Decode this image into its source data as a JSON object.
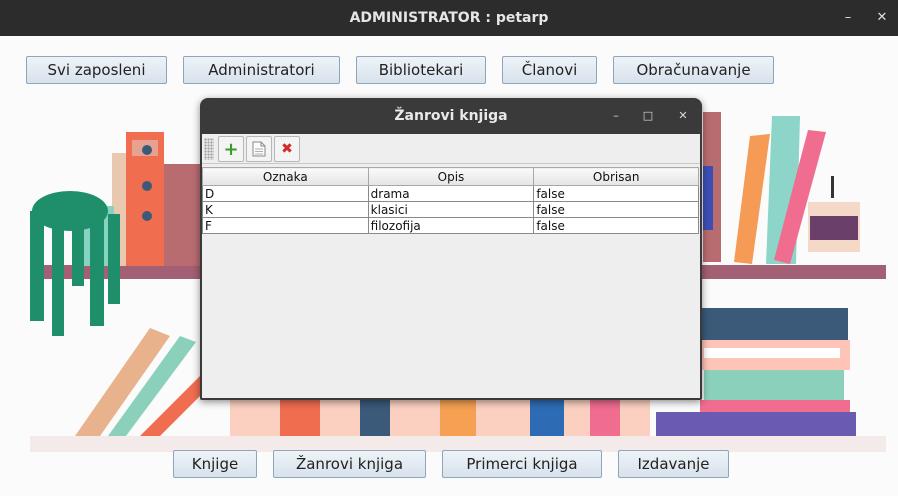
{
  "window": {
    "title": "ADMINISTRATOR : petarp",
    "minimize": "–",
    "close": "✕"
  },
  "top_nav": {
    "employees": "Svi zaposleni",
    "administrators": "Administratori",
    "librarians": "Bibliotekari",
    "members": "Članovi",
    "billing": "Obračunavanje"
  },
  "bottom_nav": {
    "books": "Knjige",
    "genres": "Žanrovi knjiga",
    "copies": "Primerci knjiga",
    "lending": "Izdavanje"
  },
  "dialog": {
    "title": "Žanrovi knjiga",
    "minimize": "–",
    "maximize": "□",
    "close": "✕",
    "toolbar": {
      "add_icon": "plus-icon",
      "add_symbol": "+",
      "edit_icon": "document-icon",
      "delete_icon": "x-icon",
      "delete_symbol": "✖"
    },
    "table": {
      "columns": [
        "Oznaka",
        "Opis",
        "Obrisan"
      ],
      "rows": [
        [
          "D",
          "drama",
          "false"
        ],
        [
          "K",
          "klasici",
          "false"
        ],
        [
          "F",
          "filozofija",
          "false"
        ]
      ]
    }
  },
  "colors": {
    "nav_button_border": "#8fa5bb",
    "add_green": "#3a9a2a",
    "delete_red": "#d42a2a",
    "titlebar": "#2c2c2c"
  }
}
